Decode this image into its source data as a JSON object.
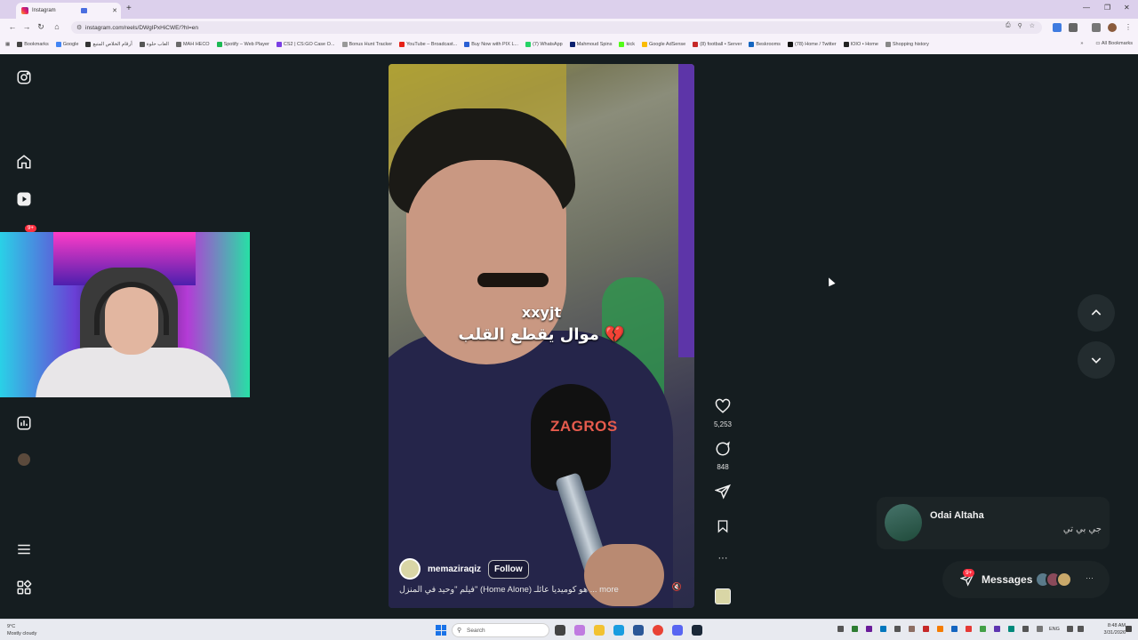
{
  "browser": {
    "tab_title": "Instagram",
    "url": "instagram.com/reels/DWgIPxHiCWE/?hl=en",
    "new_tab": "+",
    "window_controls": [
      "—",
      "❐",
      "✕"
    ],
    "bookmarks": [
      {
        "label": "Bookmarks",
        "color": "#444"
      },
      {
        "label": "Google",
        "color": "#4285f4"
      },
      {
        "label": "أرقام الخلاص المتبع",
        "color": "#333"
      },
      {
        "label": "العاب حلوة",
        "color": "#555"
      },
      {
        "label": "MAH HECO",
        "color": "#6a6a6a"
      },
      {
        "label": "Spotify – Web Player",
        "color": "#1db954"
      },
      {
        "label": "CS2 | CS:GO Case O...",
        "color": "#7b3fe4"
      },
      {
        "label": "Bonus Hunt Tracker",
        "color": "#999"
      },
      {
        "label": "YouTube – Broadcast...",
        "color": "#e62117"
      },
      {
        "label": "Buy Now with PIX L...",
        "color": "#2a5fd4"
      },
      {
        "label": "(7) WhatsApp",
        "color": "#25d366"
      },
      {
        "label": "Mahmoud Spins",
        "color": "#0a1f6e"
      },
      {
        "label": "kick",
        "color": "#53fc18"
      },
      {
        "label": "Google AdSense",
        "color": "#fbbc05"
      },
      {
        "label": "(8) football • Server",
        "color": "#c62828"
      },
      {
        "label": "Beskrooms",
        "color": "#1565c0"
      },
      {
        "label": "(78) Home / Twitter",
        "color": "#111"
      },
      {
        "label": "IOIO • Home",
        "color": "#222"
      },
      {
        "label": "Shopping history",
        "color": "#888"
      }
    ],
    "bookmarks_more": "»",
    "all_bookmarks": "All Bookmarks"
  },
  "sidebar": {
    "notification_badge": "9+"
  },
  "reel": {
    "overlay_text_top": "xxyjt",
    "overlay_text_main": "موال يقطع القلب 💔",
    "mic_brand": "ZAGROS",
    "author": "memaziraqiz",
    "follow_label": "Follow",
    "caption": "فيلم \"وحيد في المنزل\" (Home Alone) هو كوميديا عائلـ ... more",
    "likes": "5,253",
    "comments": "848",
    "more_label": "···"
  },
  "toast": {
    "name": "Odai Altaha",
    "message": "جي بي تي"
  },
  "messages": {
    "label": "Messages",
    "badge": "9+",
    "more": "···"
  },
  "taskbar": {
    "weather_temp": "9°C",
    "weather_desc": "Mostly cloudy",
    "search_placeholder": "Search",
    "lang": "ENG",
    "time": "8:48 AM",
    "date": "3/31/2026"
  },
  "colors": {
    "page_bg": "#151d20",
    "notification_red": "#ff3040",
    "tab_strip": "#dcd0ec"
  }
}
